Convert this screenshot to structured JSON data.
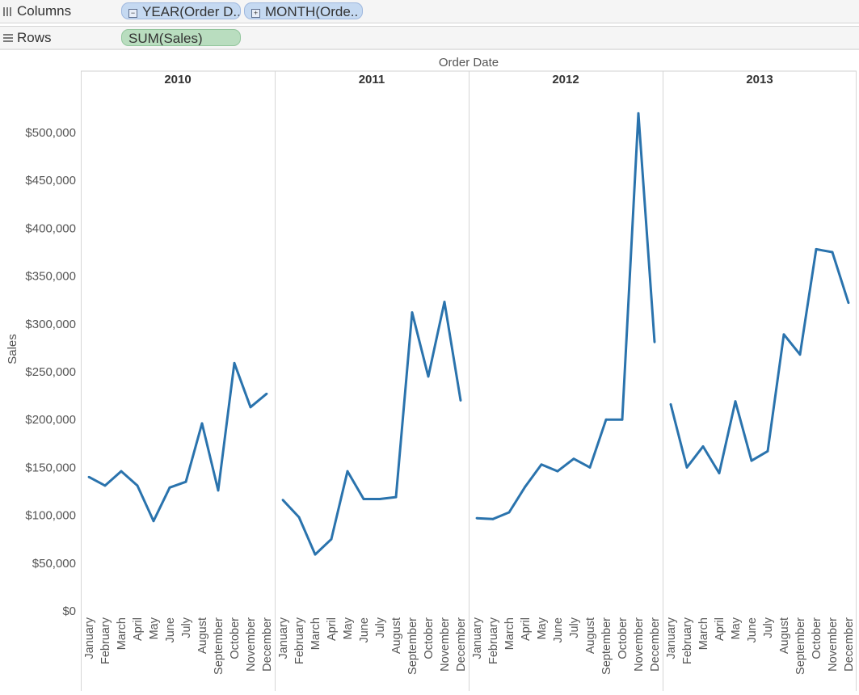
{
  "shelves": {
    "columns_label": "Columns",
    "rows_label": "Rows",
    "column_pills": [
      {
        "label": "YEAR(Order D..",
        "toggle": "−"
      },
      {
        "label": "MONTH(Orde..",
        "toggle": "+"
      }
    ],
    "row_pills": [
      {
        "label": "SUM(Sales)"
      }
    ]
  },
  "chart_data": {
    "type": "line",
    "xlabel": "Order Date",
    "ylabel": "Sales",
    "ylim": [
      0,
      550000
    ],
    "yticks": [
      0,
      50000,
      100000,
      150000,
      200000,
      250000,
      300000,
      350000,
      400000,
      450000,
      500000
    ],
    "ytick_labels": [
      "$0",
      "$50,000",
      "$100,000",
      "$150,000",
      "$200,000",
      "$250,000",
      "$300,000",
      "$350,000",
      "$400,000",
      "$450,000",
      "$500,000"
    ],
    "categories": [
      "January",
      "February",
      "March",
      "April",
      "May",
      "June",
      "July",
      "August",
      "September",
      "October",
      "November",
      "December"
    ],
    "line_color": "#2a73ad",
    "panels": [
      {
        "year": "2010",
        "values": [
          140000,
          131000,
          146000,
          131000,
          94000,
          129000,
          135000,
          196000,
          126000,
          259000,
          213000,
          227000
        ]
      },
      {
        "year": "2011",
        "values": [
          116000,
          98000,
          59000,
          75000,
          146000,
          117000,
          117000,
          119000,
          312000,
          245000,
          323000,
          220000
        ]
      },
      {
        "year": "2012",
        "values": [
          97000,
          96000,
          103000,
          130000,
          153000,
          146000,
          159000,
          150000,
          200000,
          200000,
          520000,
          281000
        ]
      },
      {
        "year": "2013",
        "values": [
          216000,
          150000,
          172000,
          144000,
          219000,
          157000,
          167000,
          289000,
          268000,
          378000,
          375000,
          322000
        ]
      }
    ]
  }
}
